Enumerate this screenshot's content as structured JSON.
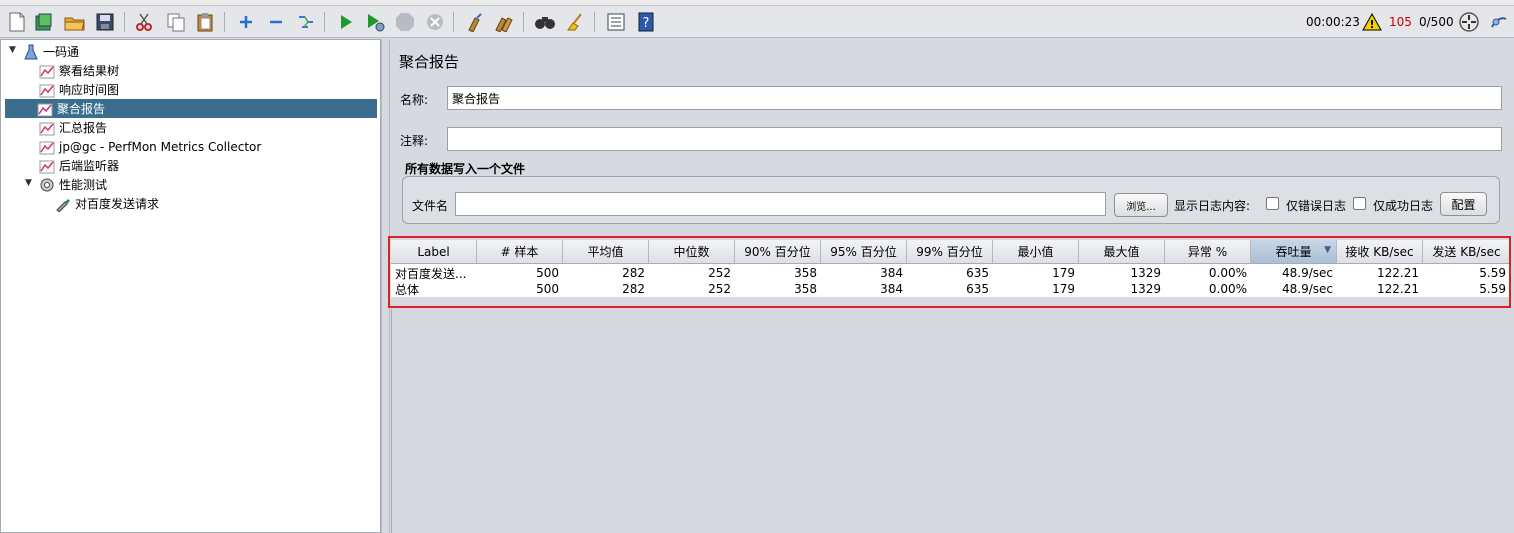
{
  "toolbar": {
    "timer": "00:00:23",
    "warning_count": "105",
    "thread_ratio": "0/500",
    "colors": {
      "warning": "#cc0000"
    }
  },
  "tree": {
    "root": "一码通",
    "items": [
      {
        "label": "察看结果树",
        "icon": "graph-icon"
      },
      {
        "label": "响应时间图",
        "icon": "graph-icon"
      },
      {
        "label": "聚合报告",
        "icon": "graph-icon",
        "selected": true
      },
      {
        "label": "汇总报告",
        "icon": "graph-icon"
      },
      {
        "label": "jp@gc - PerfMon Metrics Collector",
        "icon": "graph-icon"
      },
      {
        "label": "后端监听器",
        "icon": "graph-icon"
      }
    ],
    "thread_group": "性能测试",
    "sampler": "对百度发送请求"
  },
  "panel": {
    "title": "聚合报告",
    "name_label": "名称:",
    "name_value": "聚合报告",
    "comment_label": "注释:",
    "comment_value": "",
    "file_group_title": "所有数据写入一个文件",
    "filename_label": "文件名",
    "filename_value": "",
    "browse_label": "浏览...",
    "log_content_label": "显示日志内容:",
    "errors_only_label": "仅错误日志",
    "success_only_label": "仅成功日志",
    "configure_label": "配置"
  },
  "table": {
    "headers": [
      "Label",
      "# 样本",
      "平均值",
      "中位数",
      "90% 百分位",
      "95% 百分位",
      "99% 百分位",
      "最小值",
      "最大值",
      "异常 %",
      "吞吐量",
      "接收 KB/sec",
      "发送 KB/sec"
    ],
    "sorted_column": "吞吐量",
    "rows": [
      [
        "对百度发送...",
        "500",
        "282",
        "252",
        "358",
        "384",
        "635",
        "179",
        "1329",
        "0.00%",
        "48.9/sec",
        "122.21",
        "5.59"
      ],
      [
        "总体",
        "500",
        "282",
        "252",
        "358",
        "384",
        "635",
        "179",
        "1329",
        "0.00%",
        "48.9/sec",
        "122.21",
        "5.59"
      ]
    ]
  }
}
